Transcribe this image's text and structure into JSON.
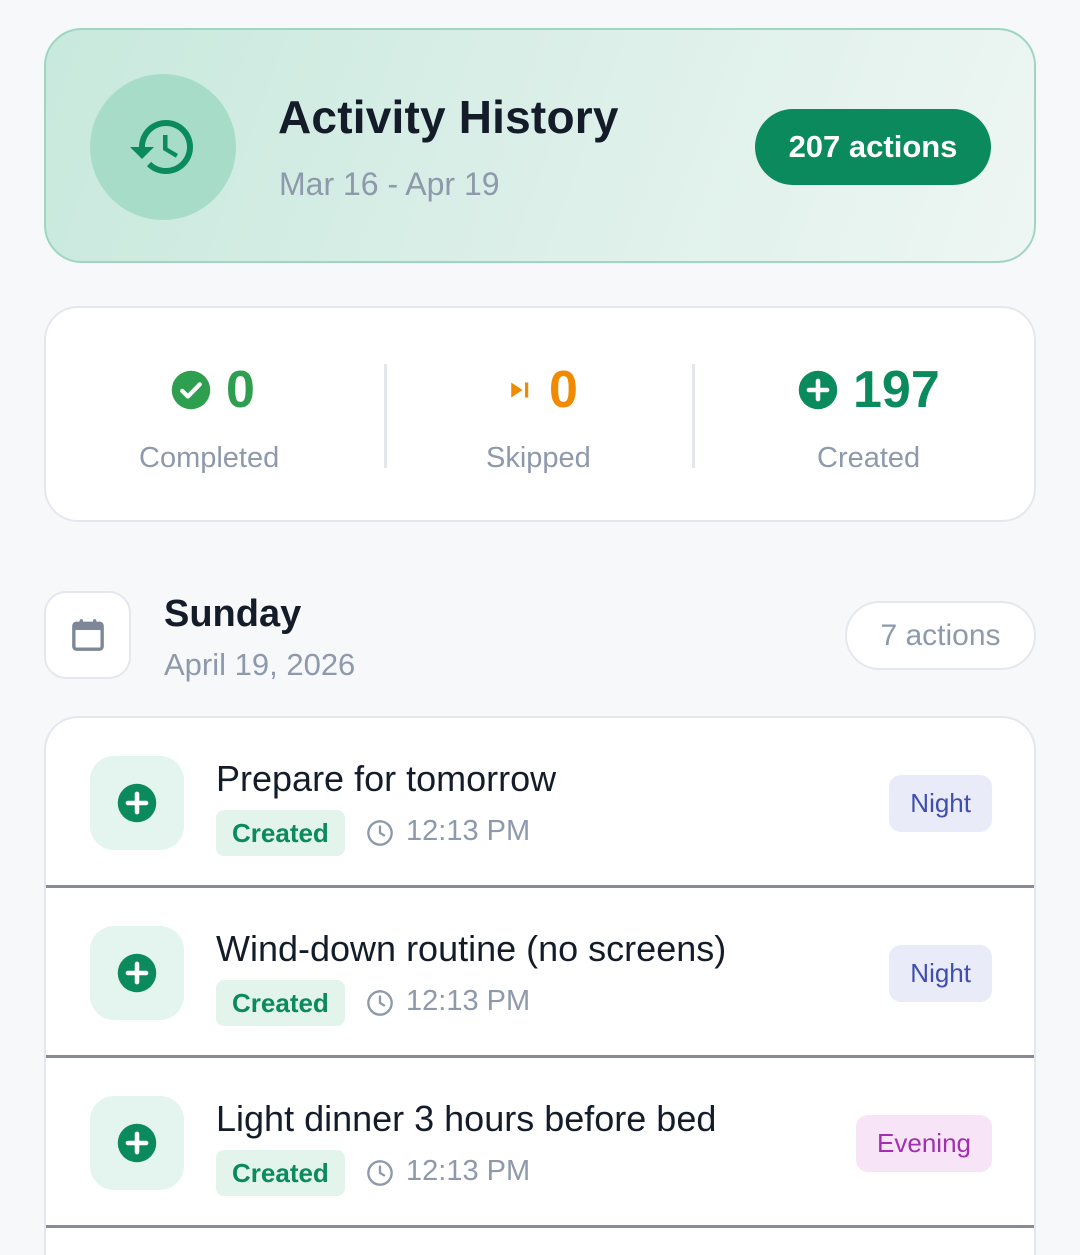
{
  "header": {
    "title": "Activity History",
    "date_range": "Mar 16 - Apr 19",
    "total_badge": "207 actions",
    "icon": "history-icon"
  },
  "stats": [
    {
      "value": "0",
      "label": "Completed",
      "icon": "check-circle-icon",
      "color": "#2e9e4f"
    },
    {
      "value": "0",
      "label": "Skipped",
      "icon": "skip-next-icon",
      "color": "#f08a00"
    },
    {
      "value": "197",
      "label": "Created",
      "icon": "add-circle-icon",
      "color": "#0b8a5e"
    }
  ],
  "day": {
    "weekday": "Sunday",
    "date": "April 19, 2026",
    "count_badge": "7 actions",
    "icon": "calendar-icon"
  },
  "items": [
    {
      "title": "Prepare for tomorrow",
      "status": "Created",
      "time": "12:13 PM",
      "tag": "Night"
    },
    {
      "title": "Wind-down routine (no screens)",
      "status": "Created",
      "time": "12:13 PM",
      "tag": "Night"
    },
    {
      "title": "Light dinner 3 hours before bed",
      "status": "Created",
      "time": "12:13 PM",
      "tag": "Evening"
    }
  ],
  "colors": {
    "accent": "#0b8a5e",
    "night_tag_bg": "#e9ebf8",
    "evening_tag_bg": "#f7e4f6"
  }
}
